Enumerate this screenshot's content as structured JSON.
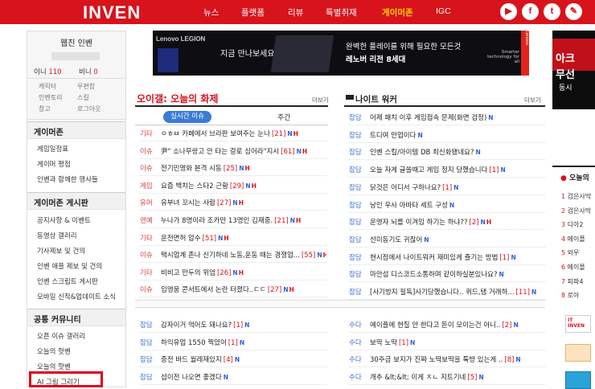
{
  "header": {
    "logo": "INVEN",
    "nav": [
      "뉴스",
      "플랫폼",
      "리뷰",
      "특별취재",
      "게이머존",
      "IGC"
    ],
    "active": "게이머존",
    "social_icons": [
      "youtube-icon",
      "facebook-icon",
      "twitter-icon",
      "blog-icon"
    ],
    "social_glyphs": [
      "▶",
      "f",
      "t",
      "✎"
    ]
  },
  "left": {
    "webzine_title": "웹진 인벤",
    "coin1_label": "이니",
    "coin1_value": "110",
    "coin2_label": "비니",
    "coin2_value": "0",
    "links": [
      "캐릭터",
      "우편함",
      "인벤토리",
      "스킬",
      "창고",
      "로그아웃"
    ],
    "gamer_zone_title": "게이머존",
    "gamer_zone_items": [
      "게임일정표",
      "게이머 평점",
      "인벤과 함께한 행사들"
    ],
    "board_title": "게이머존 게시판",
    "board_items": [
      "공지사항 & 이벤트",
      "동영상 갤러리",
      "기사제보 및 건의",
      "인벤 애플 제보 및 건의",
      "인벤 스크립트 게시판",
      "모바일 신작&업데이트 소식"
    ],
    "community_title": "공통 커뮤니티",
    "community_items": [
      "오픈 이슈 갤러리",
      "오늘의 핫벤",
      "오늘의 핫벤",
      "AI 그림 그리기"
    ]
  },
  "ad": {
    "brand": "Lenovo LEGION",
    "left_text": "지금 만나보세요",
    "line1": "완벽한 플레이를 위해 필요한 모든것",
    "line2": "레노버 리전 8세대",
    "tag": "Smarter technology for all",
    "vendor": "Lenovo"
  },
  "hot": {
    "title": "오이갤: 오늘의 화제",
    "more": "더보기",
    "tab_active": "실시간 이슈",
    "tab_other": "주간",
    "rows": [
      {
        "cat": "기타",
        "title": "ㅇㅎㅂ 카페에서 브라판 보여주는 눈나",
        "count": "[21]",
        "n": true,
        "h": true
      },
      {
        "cat": "이슈",
        "title": "尹\" 소나무랑고 안 타는 걸로 심어라\"지시",
        "count": "[61]",
        "n": true,
        "h": true
      },
      {
        "cat": "이슈",
        "title": "전기민영화 본격 시동",
        "count": "[25]",
        "n": true,
        "h": true
      },
      {
        "cat": "게임",
        "title": "요즘 백치는 스타2 근황",
        "count": "[29]",
        "n": true,
        "h": true
      },
      {
        "cat": "유머",
        "title": "유부녀 꼬시는 사람",
        "count": "[27]",
        "n": true,
        "h": true
      },
      {
        "cat": "연예",
        "title": "누나가 8명이라 조카만 13명인 김재중.",
        "count": "[21]",
        "n": true,
        "h": true
      },
      {
        "cat": "기타",
        "title": "운전면허 압수",
        "count": "[51]",
        "n": true,
        "h": true
      },
      {
        "cat": "이슈",
        "title": "택시업계 존나 신기하네 노동,운동 때는 경쟁업...",
        "count": "[55]",
        "n": true,
        "h": true
      },
      {
        "cat": "기타",
        "title": "비비고 만두의 위엄",
        "count": "[26]",
        "n": true,
        "h": true
      },
      {
        "cat": "이슈",
        "title": "임영웅 콘서트에서 논란 터졌다..ㄷㄷ",
        "count": "[27]",
        "n": true,
        "h": true
      }
    ]
  },
  "night": {
    "title": "나이트 워커",
    "more": "더보기",
    "rows": [
      {
        "cat": "잡담",
        "title": "어제 패치 이후 게임접속 문제(화면 검정)",
        "count": "",
        "n": true,
        "h": false
      },
      {
        "cat": "잡담",
        "title": "트디여 만업이다",
        "count": "",
        "n": true,
        "h": false
      },
      {
        "cat": "잡담",
        "title": "인벤 스킬/아이템 DB 최신화됐네요?",
        "count": "",
        "n": true,
        "h": false
      },
      {
        "cat": "잡담",
        "title": "오늘 자게 글쓸때고 게임 정지 당했습니다",
        "count": "[1]",
        "n": true,
        "h": false
      },
      {
        "cat": "잡담",
        "title": "닭것은 어디서 구하나요?",
        "count": "[1]",
        "n": true,
        "h": false
      },
      {
        "cat": "잡담",
        "title": "낭인 우사 아바타 세트 구성",
        "count": "",
        "n": true,
        "h": false
      },
      {
        "cat": "잡담",
        "title": "운영자 뇌를 이겨임 하기는 하냐??",
        "count": "[2]",
        "n": true,
        "h": true
      },
      {
        "cat": "잡담",
        "title": "선미동기도 귀찮어",
        "count": "",
        "n": true,
        "h": false
      },
      {
        "cat": "잡담",
        "title": "현시점에서 나이트워커 재미있게 즐기는 방법",
        "count": "[1]",
        "n": true,
        "h": false
      },
      {
        "cat": "잡담",
        "title": "마안섭 디스코드소통하며 같이하실분있나요?",
        "count": "",
        "n": true,
        "h": false
      },
      {
        "cat": "잡담",
        "title": "[사기방지 필독]사기당했습니다.. 퀴드,탬 거래하...",
        "count": "[11]",
        "n": true,
        "h": false
      }
    ]
  },
  "bottom_left": [
    {
      "cat": "잡담",
      "title": "감자이거 먹어도 돼나요?",
      "count": "[1]",
      "n": true
    },
    {
      "cat": "잡담",
      "title": "하익유업 1550 찍었어",
      "count": "[1]",
      "n": true
    },
    {
      "cat": "잡담",
      "title": "중전 바드 월레재있지",
      "count": "[4]",
      "n": true
    },
    {
      "cat": "잡담",
      "title": "섭이전 나오면 좋겠다",
      "count": "",
      "n": true
    }
  ],
  "bottom_right": [
    {
      "cat": "수다",
      "title": "에이플에 현질 안 한다고 돈이 모이는건 아니..",
      "count": "[2]",
      "n": true
    },
    {
      "cat": "수다",
      "title": "보딱 노딱",
      "count": "[1]",
      "n": true
    },
    {
      "cat": "수다",
      "title": "30주금 보지가 진짜 노딱보딱을 툭방 있는게 ..",
      "count": "[8]",
      "n": true
    },
    {
      "cat": "수다",
      "title": "개추 &lt;&lt; 이게 ㅈㄴ 지트기네",
      "count": "[5]",
      "n": true
    }
  ],
  "right": {
    "ad_line1": "아크",
    "ad_line2": "무선",
    "ad_line3": "동시",
    "today_title": "오늘의",
    "ranks": [
      {
        "n": "1",
        "t": "검은사막"
      },
      {
        "n": "2",
        "t": "검은사막"
      },
      {
        "n": "3",
        "t": "디아2"
      },
      {
        "n": "4",
        "t": "메이플"
      },
      {
        "n": "5",
        "t": "와우"
      },
      {
        "n": "6",
        "t": "메이플"
      },
      {
        "n": "7",
        "t": "피파4"
      },
      {
        "n": "8",
        "t": "로아"
      }
    ],
    "apps": [
      "IT INVEN",
      "calendar-app-icon",
      "game-app-icon"
    ]
  }
}
